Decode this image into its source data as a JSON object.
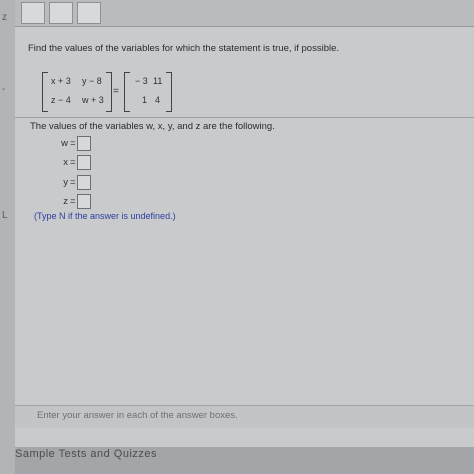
{
  "question": "Find the values of the variables for which the statement is true, if possible.",
  "matrix_left": {
    "r1c1": "x + 3",
    "r1c2": "y − 8",
    "r2c1": "z − 4",
    "r2c2": "w + 3"
  },
  "equals_sign": "=",
  "matrix_right": {
    "r1c1": "− 3",
    "r1c2": "11",
    "r2c1": "1",
    "r2c2": "4"
  },
  "values_intro": "The values of the variables w, x, y, and z are the following.",
  "variables": [
    {
      "label": "w",
      "sign": "=",
      "value": ""
    },
    {
      "label": "x",
      "sign": "=",
      "value": ""
    },
    {
      "label": "y",
      "sign": "=",
      "value": ""
    },
    {
      "label": "z",
      "sign": "=",
      "value": ""
    }
  ],
  "hint": "(Type N if the answer is undefined.)",
  "instruction": "Enter your answer in each of the answer boxes.",
  "bottom_text": "Sample Tests and Quizzes"
}
